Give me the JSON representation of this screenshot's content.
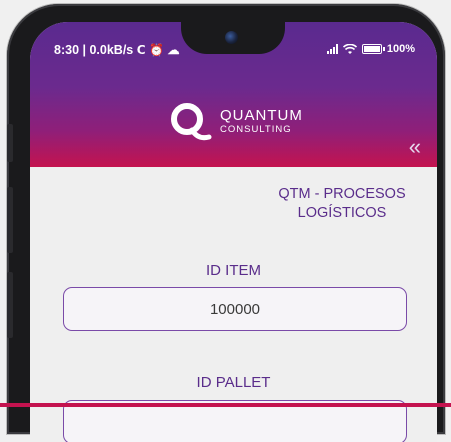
{
  "status_bar": {
    "left_text": "8:30 | 0.0kB/s",
    "left_icons": [
      "notification-icon",
      "alarm-icon",
      "cloud-icon"
    ],
    "battery": "100%"
  },
  "logo": {
    "line1": "QUANTUM",
    "line2": "CONSULTING"
  },
  "header": {
    "collapse_icon": "«"
  },
  "page": {
    "subtitle": "QTM - PROCESOS LOGÍSTICOS"
  },
  "fields": {
    "item": {
      "label": "ID ITEM",
      "value": "100000"
    },
    "pallet": {
      "label": "ID PALLET",
      "value": ""
    }
  },
  "colors": {
    "accent": "#5a2d8b",
    "header_top": "#5a2a8f",
    "header_bottom": "#c4134f"
  }
}
